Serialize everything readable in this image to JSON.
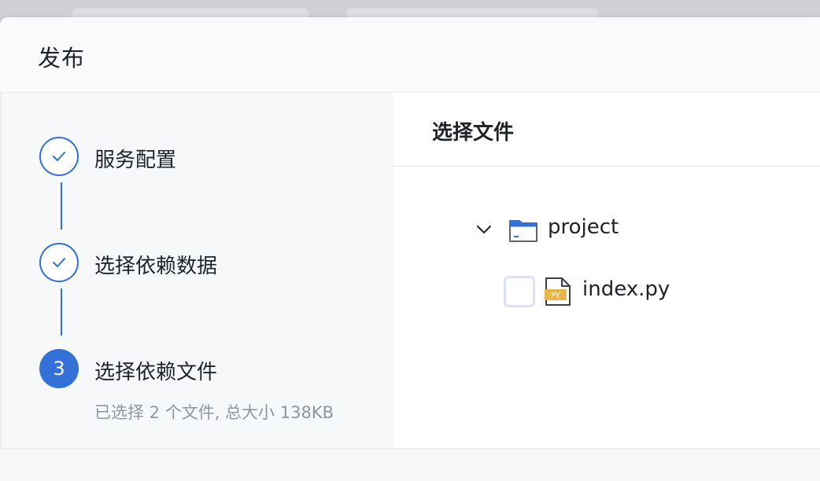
{
  "dialog": {
    "title": "发布"
  },
  "steps": [
    {
      "label": "服务配置",
      "status": "done",
      "icon": "check-icon"
    },
    {
      "label": "选择依赖数据",
      "status": "done",
      "icon": "check-icon"
    },
    {
      "label": "选择依赖文件",
      "status": "active",
      "number": "3",
      "description": "已选择 2 个文件, 总大小 138KB"
    }
  ],
  "file_picker": {
    "title": "选择文件",
    "tree": {
      "folder": {
        "name": "project",
        "expanded": true,
        "icon": "folder-icon",
        "toggle_icon": "chevron-down-icon"
      },
      "files": [
        {
          "name": "index.py",
          "checked": false,
          "icon": "python-file-icon",
          "badge": "PY"
        }
      ]
    }
  },
  "colors": {
    "accent": "#3370d8",
    "text_primary": "#1f2329",
    "text_secondary": "#8f959e",
    "py_badge": "#e6b84a"
  }
}
